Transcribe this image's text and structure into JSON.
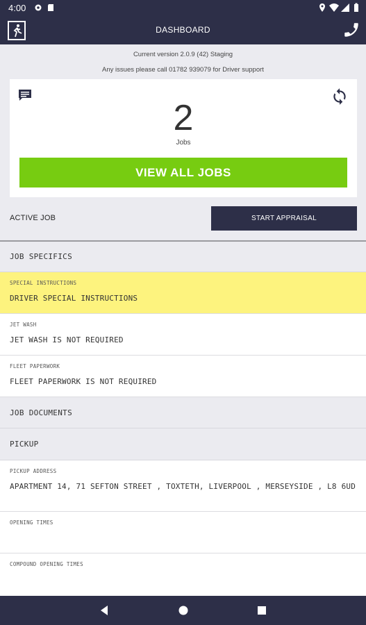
{
  "status_bar": {
    "time": "4:00"
  },
  "app_bar": {
    "title": "DASHBOARD"
  },
  "info": {
    "version": "Current version 2.0.9 (42) Staging",
    "support": "Any issues please call 01782 939079 for Driver support"
  },
  "summary": {
    "job_count": "2",
    "jobs_label": "Jobs",
    "view_all_label": "VIEW ALL JOBS"
  },
  "active_job": {
    "label": "ACTIVE JOB",
    "start_appraisal_label": "START APPRAISAL"
  },
  "sections": {
    "job_specifics": "JOB SPECIFICS",
    "job_documents": "JOB DOCUMENTS",
    "pickup": "PICKUP"
  },
  "fields": {
    "special_instructions": {
      "label": "SPECIAL INSTRUCTIONS",
      "value": "DRIVER SPECIAL INSTRUCTIONS"
    },
    "jet_wash": {
      "label": "JET WASH",
      "value": "JET WASH IS NOT REQUIRED"
    },
    "fleet_paperwork": {
      "label": "FLEET PAPERWORK",
      "value": "FLEET PAPERWORK IS NOT REQUIRED"
    },
    "pickup_address": {
      "label": "PICKUP ADDRESS",
      "value": "APARTMENT 14, 71 SEFTON STREET , TOXTETH, LIVERPOOL , MERSEYSIDE , L8 6UD"
    },
    "opening_times": {
      "label": "OPENING TIMES",
      "value": ""
    },
    "compound_opening_times": {
      "label": "COMPOUND OPENING TIMES",
      "value": ""
    }
  },
  "colors": {
    "primary": "#2d2f48",
    "accent_green": "#77cc11",
    "highlight_yellow": "#fdf37e"
  },
  "icons": {
    "exit": "exit-door-icon",
    "phone": "phone-icon",
    "chat": "chat-icon",
    "refresh": "refresh-icon",
    "back": "back-triangle-icon",
    "home": "home-circle-icon",
    "recents": "recents-square-icon"
  }
}
